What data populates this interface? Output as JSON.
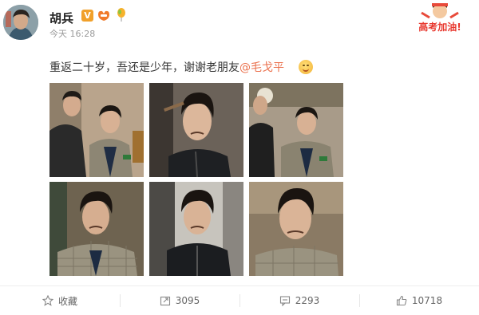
{
  "user": {
    "name": "胡兵",
    "verified_badge": "V",
    "time": "今天 16:28",
    "badge_icons": [
      "vip-icon",
      "balloon-icon"
    ]
  },
  "sticker": {
    "text": "高考加油!"
  },
  "post": {
    "text": "重返二十岁，吾还是少年，谢谢老朋友",
    "mention": "@毛戈平",
    "emoji": "smile-emoji-icon"
  },
  "photos": [
    {
      "name": "photo-makeup-artist-and-man"
    },
    {
      "name": "photo-man-with-brush"
    },
    {
      "name": "photo-two-men-standing"
    },
    {
      "name": "photo-man-plaid-blazer"
    },
    {
      "name": "photo-man-dark-jacket"
    },
    {
      "name": "photo-man-closeup"
    }
  ],
  "toolbar": {
    "favorite": "收藏",
    "repost": "3095",
    "comment": "2293",
    "like": "10718"
  },
  "colors": {
    "mention": "#eb7350",
    "verified": "#f1a02a",
    "meta": "#9a9a9a"
  }
}
